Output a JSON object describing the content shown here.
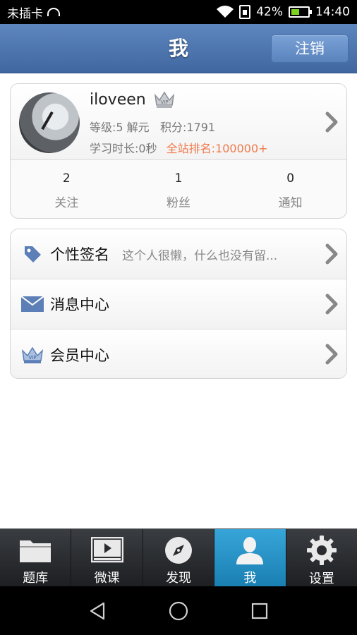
{
  "status_bar": {
    "carrier": "未插卡",
    "battery": "42%",
    "time": "14:40"
  },
  "header": {
    "title": "我",
    "logout_label": "注销"
  },
  "profile": {
    "username": "iloveen",
    "level": "等级:5 解元",
    "points": "积分:1791",
    "study_time": "学习时长:0秒",
    "site_rank": "全站排名:100000+",
    "stats": [
      {
        "value": "2",
        "label": "关注"
      },
      {
        "value": "1",
        "label": "粉丝"
      },
      {
        "value": "0",
        "label": "通知"
      }
    ]
  },
  "menu": {
    "signature_label": "个性签名",
    "signature_value": "这个人很懒，什么也没有留...",
    "messages_label": "消息中心",
    "vip_label": "会员中心"
  },
  "tabs": [
    {
      "label": "题库",
      "icon": "folder-icon"
    },
    {
      "label": "微课",
      "icon": "video-icon"
    },
    {
      "label": "发现",
      "icon": "compass-icon"
    },
    {
      "label": "我",
      "icon": "user-icon"
    },
    {
      "label": "设置",
      "icon": "gear-icon"
    }
  ],
  "colors": {
    "header_bg": "#4f77b0",
    "active_tab": "#2a95c9",
    "rank_highlight": "#f07a4a"
  }
}
